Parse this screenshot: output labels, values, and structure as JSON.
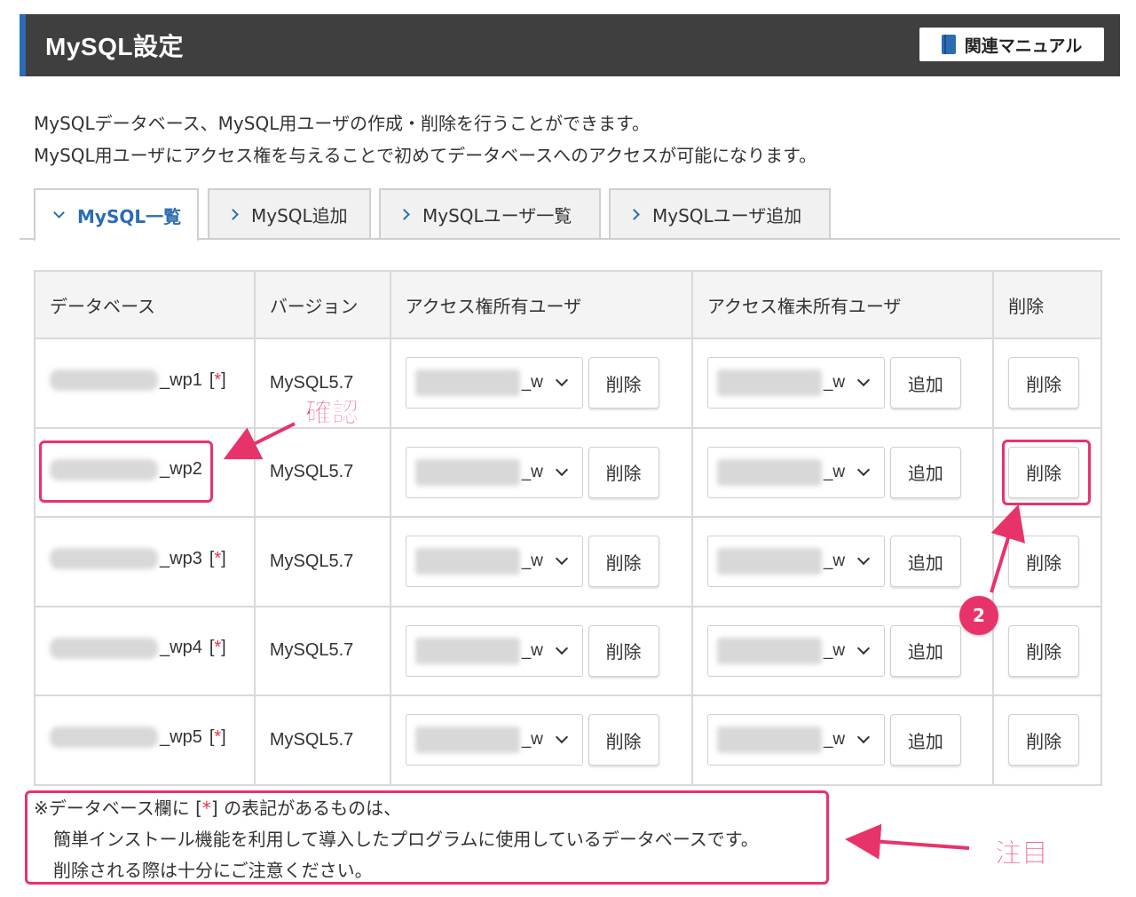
{
  "header": {
    "title": "MySQL設定",
    "manual_label": "関連マニュアル"
  },
  "description": [
    "MySQLデータベース、MySQL用ユーザの作成・削除を行うことができます。",
    "MySQL用ユーザにアクセス権を与えることで初めてデータベースへのアクセスが可能になります。"
  ],
  "tabs": [
    {
      "label": "MySQL一覧",
      "active": true
    },
    {
      "label": "MySQL追加",
      "active": false
    },
    {
      "label": "MySQLユーザ一覧",
      "active": false
    },
    {
      "label": "MySQLユーザ追加",
      "active": false
    }
  ],
  "table": {
    "headers": [
      "データベース",
      "バージョン",
      "アクセス権所有ユーザ",
      "アクセス権未所有ユーザ",
      "削除"
    ],
    "rows": [
      {
        "db": "_wp1",
        "mark": "[*]",
        "version": "MySQL5.7",
        "owner_suffix": "_w",
        "nonowner_suffix": "_w"
      },
      {
        "db": "_wp2",
        "mark": "",
        "version": "MySQL5.7",
        "owner_suffix": "_w",
        "nonowner_suffix": "_w"
      },
      {
        "db": "_wp3",
        "mark": "[*]",
        "version": "MySQL5.7",
        "owner_suffix": "_w",
        "nonowner_suffix": "_w"
      },
      {
        "db": "_wp4",
        "mark": "[*]",
        "version": "MySQL5.7",
        "owner_suffix": "_w",
        "nonowner_suffix": "_w"
      },
      {
        "db": "_wp5",
        "mark": "[*]",
        "version": "MySQL5.7",
        "owner_suffix": "_w",
        "nonowner_suffix": "_w"
      }
    ],
    "delete_label": "削除",
    "add_label": "追加"
  },
  "note": {
    "line1_pre": "※データベース欄に [",
    "line1_star": "*",
    "line1_post": "] の表記があるものは、",
    "line2": "簡単インストール機能を利用して導入したプログラムに使用しているデータベースです。",
    "line3": "削除される際は十分にご注意ください。"
  },
  "annotations": {
    "confirm": "確認",
    "attention": "注目",
    "step": "2",
    "color": "#e8336a"
  },
  "colors": {
    "header_bg": "#3f3f3f",
    "accent": "#2b6cb4",
    "required_mark": "#e5334b"
  }
}
